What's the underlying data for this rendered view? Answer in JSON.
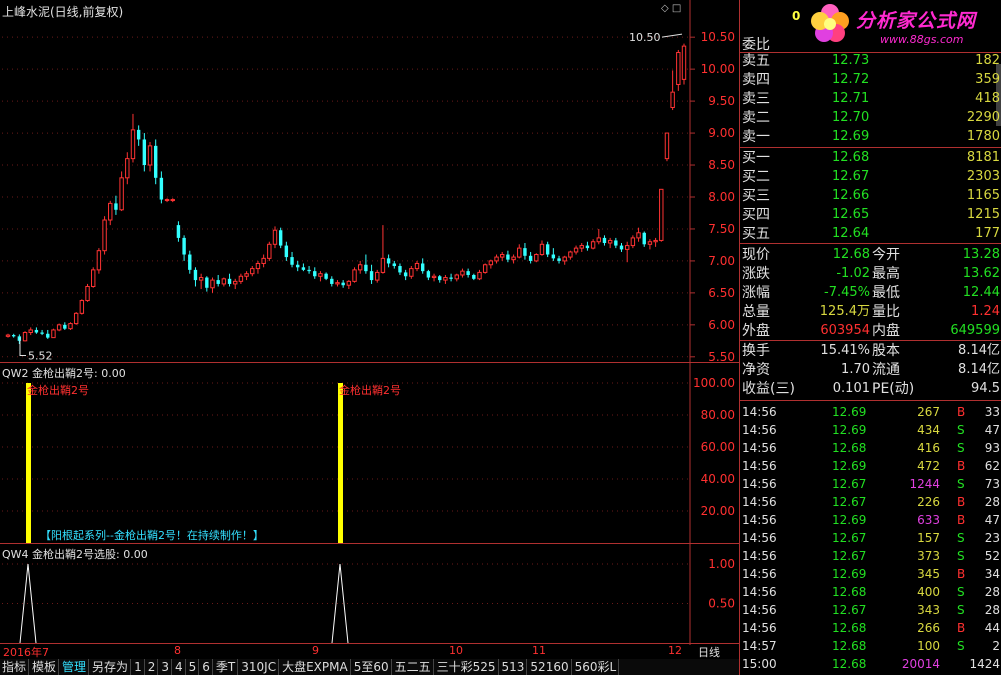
{
  "chart": {
    "title": "上峰水泥(日线,前复权)",
    "high_label": "10.50",
    "low_label": "5.52",
    "y_ticks": [
      "10.50",
      "10.00",
      "9.50",
      "9.00",
      "8.50",
      "8.00",
      "7.50",
      "7.00",
      "6.50",
      "6.00",
      "5.50"
    ],
    "x_labels": [
      "2016年7",
      "8",
      "9",
      "10",
      "11",
      "12"
    ],
    "period": "日线"
  },
  "indicator1": {
    "header": "QW2 金枪出鞘2号: 0.00",
    "signal_labels": [
      "金枪出鞘2号",
      "金枪出鞘2号"
    ],
    "y_ticks": [
      "100.00",
      "80.00",
      "60.00",
      "40.00",
      "20.00"
    ],
    "footer_text": "【阳根起系列--金枪出鞘2号！在持续制作！】"
  },
  "indicator2": {
    "header": "QW4 金枪出鞘2号选股: 0.00",
    "y_ticks": [
      "1.00",
      "0.50"
    ]
  },
  "watermark": {
    "text": "分析家公式网",
    "url": "www.88gs.com",
    "badge": "0"
  },
  "orderbook": {
    "weibi_label": "委比",
    "asks": [
      {
        "label": "卖五",
        "price": "12.73",
        "vol": "182"
      },
      {
        "label": "卖四",
        "price": "12.72",
        "vol": "359"
      },
      {
        "label": "卖三",
        "price": "12.71",
        "vol": "418"
      },
      {
        "label": "卖二",
        "price": "12.70",
        "vol": "2290"
      },
      {
        "label": "卖一",
        "price": "12.69",
        "vol": "1780"
      }
    ],
    "bids": [
      {
        "label": "买一",
        "price": "12.68",
        "vol": "8181"
      },
      {
        "label": "买二",
        "price": "12.67",
        "vol": "2303"
      },
      {
        "label": "买三",
        "price": "12.66",
        "vol": "1165"
      },
      {
        "label": "买四",
        "price": "12.65",
        "vol": "1215"
      },
      {
        "label": "买五",
        "price": "12.64",
        "vol": "177"
      }
    ]
  },
  "quote": {
    "rows": [
      {
        "l1": "现价",
        "v1": "12.68",
        "c1": "#22e022",
        "l2": "今开",
        "v2": "13.28",
        "c2": "#22e022"
      },
      {
        "l1": "涨跌",
        "v1": "-1.02",
        "c1": "#22e022",
        "l2": "最高",
        "v2": "13.62",
        "c2": "#22e022"
      },
      {
        "l1": "涨幅",
        "v1": "-7.45%",
        "c1": "#22e022",
        "l2": "最低",
        "v2": "12.44",
        "c2": "#22e022"
      },
      {
        "l1": "总量",
        "v1": "125.4万",
        "c1": "#d8d840",
        "l2": "量比",
        "v2": "1.24",
        "c2": "#ff3030"
      },
      {
        "l1": "外盘",
        "v1": "603954",
        "c1": "#ff3030",
        "l2": "内盘",
        "v2": "649599",
        "c2": "#22e022"
      }
    ],
    "rows2": [
      {
        "l1": "换手",
        "v1": "15.41%",
        "l2": "股本",
        "v2": "8.14亿"
      },
      {
        "l1": "净资",
        "v1": "1.70",
        "l2": "流通",
        "v2": "8.14亿"
      },
      {
        "l1": "收益(三)",
        "v1": "0.101",
        "l2": "PE(动)",
        "v2": "94.5"
      }
    ]
  },
  "ticks": [
    {
      "t": "14:56",
      "p": "12.69",
      "v": "267",
      "vc": "#d8d840",
      "s": "B",
      "n": "33"
    },
    {
      "t": "14:56",
      "p": "12.69",
      "v": "434",
      "vc": "#d8d840",
      "s": "S",
      "n": "47"
    },
    {
      "t": "14:56",
      "p": "12.68",
      "v": "416",
      "vc": "#d8d840",
      "s": "S",
      "n": "93"
    },
    {
      "t": "14:56",
      "p": "12.69",
      "v": "472",
      "vc": "#d8d840",
      "s": "B",
      "n": "62"
    },
    {
      "t": "14:56",
      "p": "12.67",
      "v": "1244",
      "vc": "#e040e0",
      "s": "S",
      "n": "73"
    },
    {
      "t": "14:56",
      "p": "12.67",
      "v": "226",
      "vc": "#d8d840",
      "s": "B",
      "n": "28"
    },
    {
      "t": "14:56",
      "p": "12.69",
      "v": "633",
      "vc": "#e040e0",
      "s": "B",
      "n": "47"
    },
    {
      "t": "14:56",
      "p": "12.67",
      "v": "157",
      "vc": "#d8d840",
      "s": "S",
      "n": "23"
    },
    {
      "t": "14:56",
      "p": "12.67",
      "v": "373",
      "vc": "#d8d840",
      "s": "S",
      "n": "52"
    },
    {
      "t": "14:56",
      "p": "12.69",
      "v": "345",
      "vc": "#d8d840",
      "s": "B",
      "n": "34"
    },
    {
      "t": "14:56",
      "p": "12.68",
      "v": "400",
      "vc": "#d8d840",
      "s": "S",
      "n": "28"
    },
    {
      "t": "14:56",
      "p": "12.67",
      "v": "343",
      "vc": "#d8d840",
      "s": "S",
      "n": "28"
    },
    {
      "t": "14:56",
      "p": "12.68",
      "v": "266",
      "vc": "#d8d840",
      "s": "B",
      "n": "44"
    },
    {
      "t": "14:57",
      "p": "12.68",
      "v": "100",
      "vc": "#d8d840",
      "s": "S",
      "n": "2"
    },
    {
      "t": "15:00",
      "p": "12.68",
      "v": "20014",
      "vc": "#e040e0",
      "s": "",
      "n": "1424"
    }
  ],
  "bottom_tabs": [
    "指标",
    "模板",
    "管理",
    "另存为",
    "1",
    "2",
    "3",
    "4",
    "5",
    "6",
    "季T",
    "310JC",
    "大盘EXPMA",
    "5至60",
    "五二五",
    "三十彩525",
    "513",
    "52160",
    "560彩L"
  ],
  "colors": {
    "up": "#ff3333",
    "down": "#33ffff",
    "axis": "#b03030",
    "signal": "#ffff00"
  },
  "chart_data": {
    "type": "candlestick",
    "title": "上峰水泥(日线,前复权)",
    "ylim": [
      5.45,
      10.8
    ],
    "x_categories": [
      "2016年7",
      "8",
      "9",
      "10",
      "11",
      "12"
    ],
    "candles": [
      [
        5.82,
        5.86,
        5.8,
        5.84
      ],
      [
        5.84,
        5.86,
        5.8,
        5.82
      ],
      [
        5.82,
        5.85,
        5.7,
        5.75
      ],
      [
        5.75,
        5.9,
        5.74,
        5.88
      ],
      [
        5.88,
        5.96,
        5.84,
        5.92
      ],
      [
        5.92,
        5.96,
        5.86,
        5.88
      ],
      [
        5.88,
        5.92,
        5.84,
        5.86
      ],
      [
        5.86,
        5.92,
        5.78,
        5.8
      ],
      [
        5.8,
        5.94,
        5.8,
        5.92
      ],
      [
        5.92,
        6.02,
        5.9,
        6.0
      ],
      [
        6.0,
        6.04,
        5.92,
        5.94
      ],
      [
        5.94,
        6.04,
        5.92,
        6.02
      ],
      [
        6.02,
        6.2,
        6.0,
        6.18
      ],
      [
        6.18,
        6.4,
        6.16,
        6.38
      ],
      [
        6.38,
        6.64,
        6.36,
        6.6
      ],
      [
        6.6,
        6.9,
        6.58,
        6.86
      ],
      [
        6.86,
        7.2,
        6.8,
        7.16
      ],
      [
        7.16,
        7.7,
        7.1,
        7.64
      ],
      [
        7.64,
        7.94,
        7.56,
        7.9
      ],
      [
        7.9,
        8.02,
        7.72,
        7.8
      ],
      [
        7.8,
        8.4,
        7.78,
        8.3
      ],
      [
        8.3,
        8.7,
        8.2,
        8.6
      ],
      [
        8.6,
        9.3,
        8.54,
        9.05
      ],
      [
        9.05,
        9.12,
        8.8,
        8.9
      ],
      [
        8.9,
        9.0,
        8.4,
        8.5
      ],
      [
        8.5,
        8.86,
        8.4,
        8.8
      ],
      [
        8.8,
        8.9,
        8.2,
        8.3
      ],
      [
        8.3,
        8.4,
        7.9,
        7.96
      ],
      [
        7.96,
        7.98,
        7.92,
        7.96
      ],
      [
        7.96,
        7.98,
        7.92,
        7.96
      ],
      [
        7.56,
        7.62,
        7.3,
        7.36
      ],
      [
        7.36,
        7.4,
        7.0,
        7.1
      ],
      [
        7.1,
        7.16,
        6.8,
        6.86
      ],
      [
        6.86,
        6.9,
        6.6,
        6.7
      ],
      [
        6.7,
        6.8,
        6.56,
        6.74
      ],
      [
        6.74,
        6.76,
        6.52,
        6.58
      ],
      [
        6.58,
        6.74,
        6.5,
        6.7
      ],
      [
        6.7,
        6.78,
        6.6,
        6.64
      ],
      [
        6.64,
        6.74,
        6.6,
        6.72
      ],
      [
        6.72,
        6.8,
        6.6,
        6.64
      ],
      [
        6.64,
        6.72,
        6.56,
        6.68
      ],
      [
        6.68,
        6.8,
        6.64,
        6.76
      ],
      [
        6.76,
        6.84,
        6.7,
        6.8
      ],
      [
        6.8,
        6.92,
        6.76,
        6.88
      ],
      [
        6.88,
        7.0,
        6.8,
        6.96
      ],
      [
        6.96,
        7.1,
        6.9,
        7.04
      ],
      [
        7.04,
        7.3,
        7.0,
        7.26
      ],
      [
        7.26,
        7.54,
        7.2,
        7.48
      ],
      [
        7.48,
        7.52,
        7.2,
        7.24
      ],
      [
        7.24,
        7.3,
        7.0,
        7.06
      ],
      [
        7.06,
        7.14,
        6.9,
        6.94
      ],
      [
        6.94,
        7.0,
        6.84,
        6.9
      ],
      [
        6.9,
        6.96,
        6.84,
        6.86
      ],
      [
        6.86,
        6.92,
        6.8,
        6.84
      ],
      [
        6.84,
        6.9,
        6.72,
        6.76
      ],
      [
        6.76,
        6.84,
        6.68,
        6.8
      ],
      [
        6.8,
        6.82,
        6.7,
        6.72
      ],
      [
        6.72,
        6.76,
        6.6,
        6.64
      ],
      [
        6.64,
        6.7,
        6.6,
        6.66
      ],
      [
        6.66,
        6.7,
        6.58,
        6.62
      ],
      [
        6.62,
        6.7,
        6.56,
        6.68
      ],
      [
        6.68,
        6.9,
        6.66,
        6.86
      ],
      [
        6.86,
        7.0,
        6.8,
        6.94
      ],
      [
        6.94,
        7.1,
        6.8,
        6.84
      ],
      [
        6.84,
        6.94,
        6.64,
        6.7
      ],
      [
        6.7,
        6.86,
        6.66,
        6.82
      ],
      [
        6.82,
        7.56,
        6.8,
        7.04
      ],
      [
        7.04,
        7.1,
        6.9,
        6.96
      ],
      [
        6.96,
        7.0,
        6.88,
        6.92
      ],
      [
        6.92,
        6.96,
        6.78,
        6.82
      ],
      [
        6.82,
        6.86,
        6.7,
        6.76
      ],
      [
        6.76,
        6.92,
        6.72,
        6.88
      ],
      [
        6.88,
        7.0,
        6.84,
        6.96
      ],
      [
        6.96,
        7.04,
        6.8,
        6.84
      ],
      [
        6.84,
        6.86,
        6.7,
        6.74
      ],
      [
        6.74,
        6.8,
        6.68,
        6.76
      ],
      [
        6.76,
        6.78,
        6.66,
        6.7
      ],
      [
        6.7,
        6.78,
        6.64,
        6.74
      ],
      [
        6.74,
        6.8,
        6.68,
        6.72
      ],
      [
        6.72,
        6.8,
        6.68,
        6.78
      ],
      [
        6.78,
        6.88,
        6.74,
        6.84
      ],
      [
        6.84,
        6.88,
        6.74,
        6.78
      ],
      [
        6.78,
        6.8,
        6.7,
        6.72
      ],
      [
        6.72,
        6.86,
        6.7,
        6.82
      ],
      [
        6.82,
        6.96,
        6.8,
        6.94
      ],
      [
        6.94,
        7.02,
        6.88,
        7.0
      ],
      [
        7.0,
        7.1,
        6.96,
        7.06
      ],
      [
        7.06,
        7.14,
        7.0,
        7.1
      ],
      [
        7.1,
        7.16,
        6.98,
        7.02
      ],
      [
        7.02,
        7.1,
        6.96,
        7.06
      ],
      [
        7.06,
        7.26,
        7.04,
        7.2
      ],
      [
        7.2,
        7.28,
        7.02,
        7.08
      ],
      [
        7.08,
        7.14,
        6.96,
        7.0
      ],
      [
        7.0,
        7.12,
        6.98,
        7.1
      ],
      [
        7.1,
        7.32,
        7.08,
        7.26
      ],
      [
        7.26,
        7.3,
        7.06,
        7.1
      ],
      [
        7.1,
        7.2,
        7.0,
        7.04
      ],
      [
        7.04,
        7.08,
        6.96,
        7.0
      ],
      [
        7.0,
        7.08,
        6.94,
        7.06
      ],
      [
        7.06,
        7.16,
        7.02,
        7.14
      ],
      [
        7.14,
        7.24,
        7.1,
        7.2
      ],
      [
        7.2,
        7.28,
        7.14,
        7.24
      ],
      [
        7.24,
        7.3,
        7.16,
        7.2
      ],
      [
        7.2,
        7.34,
        7.18,
        7.3
      ],
      [
        7.3,
        7.5,
        7.26,
        7.36
      ],
      [
        7.36,
        7.4,
        7.24,
        7.28
      ],
      [
        7.28,
        7.36,
        7.2,
        7.32
      ],
      [
        7.32,
        7.36,
        7.2,
        7.24
      ],
      [
        7.24,
        7.28,
        7.14,
        7.18
      ],
      [
        7.18,
        7.3,
        6.98,
        7.24
      ],
      [
        7.24,
        7.4,
        7.2,
        7.36
      ],
      [
        7.36,
        7.52,
        7.3,
        7.44
      ],
      [
        7.44,
        7.46,
        7.22,
        7.26
      ],
      [
        7.26,
        7.34,
        7.18,
        7.3
      ],
      [
        7.3,
        7.36,
        7.22,
        7.32
      ],
      [
        7.32,
        8.12,
        7.3,
        8.12
      ],
      [
        8.6,
        9.0,
        8.56,
        9.0
      ],
      [
        9.4,
        9.98,
        9.36,
        9.64
      ],
      [
        9.76,
        10.3,
        9.66,
        10.26
      ],
      [
        9.84,
        10.4,
        9.76,
        10.36
      ]
    ],
    "high_marker": 10.5,
    "low_marker": 5.52
  }
}
